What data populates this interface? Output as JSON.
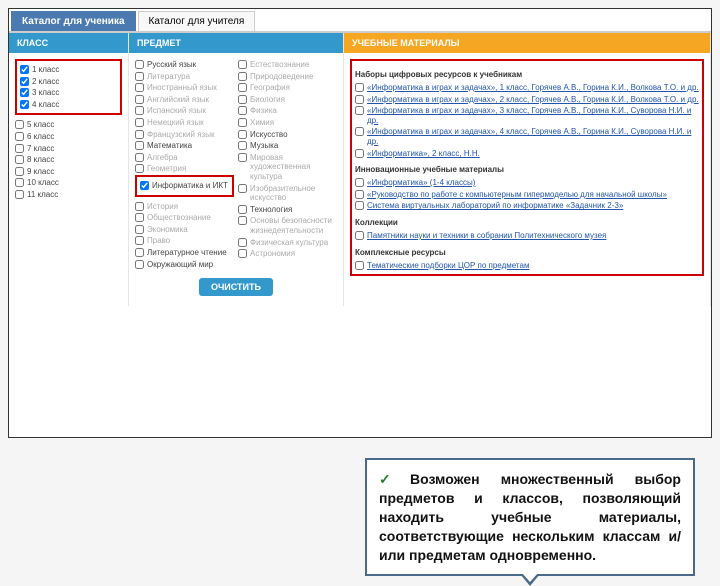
{
  "tabs": {
    "active": "Каталог для ученика",
    "inactive": "Каталог для учителя"
  },
  "headers": {
    "klass": "КЛАСС",
    "predmet": "ПРЕДМЕТ",
    "materials": "УЧЕБНЫЕ МАТЕРИАЛЫ"
  },
  "klass": {
    "highlighted": [
      {
        "label": "1 класс",
        "checked": true
      },
      {
        "label": "2 класс",
        "checked": true
      },
      {
        "label": "3 класс",
        "checked": true
      },
      {
        "label": "4 класс",
        "checked": true
      }
    ],
    "rest": [
      {
        "label": "5 класс",
        "checked": false
      },
      {
        "label": "6 класс",
        "checked": false
      },
      {
        "label": "7 класс",
        "checked": false
      },
      {
        "label": "8 класс",
        "checked": false
      },
      {
        "label": "9 класс",
        "checked": false
      },
      {
        "label": "10 класс",
        "checked": false
      },
      {
        "label": "11 класс",
        "checked": false
      }
    ]
  },
  "predmet": {
    "col1": [
      {
        "label": "Русский язык",
        "checked": false
      },
      {
        "label": "Литература",
        "checked": false,
        "dim": true
      },
      {
        "label": "Иностранный язык",
        "checked": false,
        "dim": true
      },
      {
        "label": "Английский язык",
        "checked": false,
        "dim": true
      },
      {
        "label": "Испанский язык",
        "checked": false,
        "dim": true
      },
      {
        "label": "Немецкий язык",
        "checked": false,
        "dim": true
      },
      {
        "label": "Французский язык",
        "checked": false,
        "dim": true
      },
      {
        "label": "Математика",
        "checked": false
      },
      {
        "label": "Алгебра",
        "checked": false,
        "dim": true
      },
      {
        "label": "Геометрия",
        "checked": false,
        "dim": true
      }
    ],
    "highlighted": {
      "label": "Информатика и ИКТ",
      "checked": true
    },
    "col1_after": [
      {
        "label": "История",
        "checked": false,
        "dim": true
      },
      {
        "label": "Обществознание",
        "checked": false,
        "dim": true
      },
      {
        "label": "Экономика",
        "checked": false,
        "dim": true
      },
      {
        "label": "Право",
        "checked": false,
        "dim": true
      },
      {
        "label": "Литературное чтение",
        "checked": false
      },
      {
        "label": "Окружающий мир",
        "checked": false
      }
    ],
    "col2": [
      {
        "label": "Естествознание",
        "checked": false,
        "dim": true
      },
      {
        "label": "Природоведение",
        "checked": false,
        "dim": true
      },
      {
        "label": "География",
        "checked": false,
        "dim": true
      },
      {
        "label": "Биология",
        "checked": false,
        "dim": true
      },
      {
        "label": "Физика",
        "checked": false,
        "dim": true
      },
      {
        "label": "Химия",
        "checked": false,
        "dim": true
      },
      {
        "label": "Искусство",
        "checked": false
      },
      {
        "label": "Музыка",
        "checked": false
      },
      {
        "label": "Мировая художественная культура",
        "checked": false,
        "dim": true
      },
      {
        "label": "Изобразительное искусство",
        "checked": false,
        "dim": true
      },
      {
        "label": "Технология",
        "checked": false
      },
      {
        "label": "Основы безопасности жизнедеятельности",
        "checked": false,
        "dim": true
      },
      {
        "label": "Физическая культура",
        "checked": false,
        "dim": true
      },
      {
        "label": "Астрономия",
        "checked": false,
        "dim": true
      }
    ]
  },
  "materials": {
    "s1_title": "Наборы цифровых ресурсов к учебникам",
    "s1": [
      "«Информатика в играх и задачах», 1 класс, Горячев А.В., Горина К.И., Волкова Т.О. и др.",
      "«Информатика в играх и задачах», 2 класс, Горячев А.В., Горина К.И., Волкова Т.О. и др.",
      "«Информатика в играх и задачах», 3 класс, Горячев А.В., Горина К.И., Суворова Н.И. и др.",
      "«Информатика в играх и задачах», 4 класс, Горячев А.В., Горина К.И., Суворова Н.И. и др.",
      "«Информатика», 2 класс, Н.Н."
    ],
    "s2_title": "Инновационные учебные материалы",
    "s2": [
      "«Информатика» (1-4 классы)",
      "«Руководство по работе с компьютерным гипермоделью для начальной школы»",
      "Система виртуальных лабораторий по информатике «Задачник 2-3»"
    ],
    "s3_title": "Коллекции",
    "s3": [
      "Памятники науки и техники в собрании Политехнического музея"
    ],
    "s4_title": "Комплексные ресурсы",
    "s4": [
      "Тематические подборки ЦОР по предметам"
    ]
  },
  "button": "ОЧИСТИТЬ",
  "callout": "Возможен множественный выбор предметов и классов, позволяющий находить учебные материалы, соответствующие нескольким классам и/или предметам одновременно."
}
